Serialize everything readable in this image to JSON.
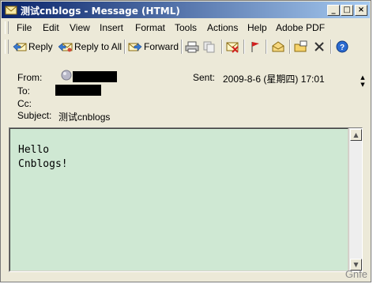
{
  "window": {
    "title": "测试cnblogs - Message (HTML)",
    "controls": {
      "minimize": "_",
      "maximize": "□",
      "close": "×"
    }
  },
  "menu": {
    "items": [
      "File",
      "Edit",
      "View",
      "Insert",
      "Format",
      "Tools",
      "Actions",
      "Help",
      "Adobe PDF"
    ]
  },
  "toolbar": {
    "reply_label": "Reply",
    "reply_all_label": "Reply to All",
    "forward_label": "Forward"
  },
  "header": {
    "from_label": "From:",
    "to_label": "To:",
    "cc_label": "Cc:",
    "subject_label": "Subject:",
    "subject_value": "测试cnblogs",
    "sent_label": "Sent:",
    "sent_value": "2009-8-6 (星期四) 17:01"
  },
  "message": {
    "line1": "Hello",
    "line2": "Cnblogs!"
  },
  "watermark": "Gnfe",
  "colors": {
    "titlebar_start": "#0a246a",
    "titlebar_end": "#a6caf0",
    "body_background": "#cfe8d3",
    "chrome": "#ece9d8"
  }
}
